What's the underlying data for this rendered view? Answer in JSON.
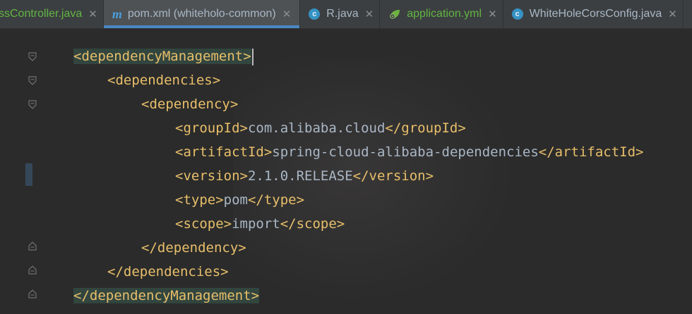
{
  "tabs": [
    {
      "label": "ssController.java",
      "icon": "none",
      "active": false
    },
    {
      "label": "pom.xml (whiteholo-common)",
      "icon": "maven-m-icon",
      "active": true
    },
    {
      "label": "R.java",
      "icon": "class-c-icon",
      "active": false
    },
    {
      "label": "application.yml",
      "icon": "spring-leaf-icon",
      "active": false
    },
    {
      "label": "WhiteHoleCorsConfig.java",
      "icon": "class-c-icon",
      "active": false
    }
  ],
  "close_glyph": "✕",
  "code": {
    "l1": {
      "open": "<dependencyManagement>"
    },
    "l2": {
      "open": "<dependencies>"
    },
    "l3": {
      "open": "<dependency>"
    },
    "l4": {
      "open": "<groupId>",
      "value": "com.alibaba.cloud",
      "close": "</groupId>"
    },
    "l5": {
      "open": "<artifactId>",
      "value": "spring-cloud-alibaba-dependencies",
      "close": "</artifactId>"
    },
    "l6": {
      "open": "<version>",
      "value": "2.1.0.RELEASE",
      "close": "</version>"
    },
    "l7": {
      "open": "<type>",
      "value": "pom",
      "close": "</type>"
    },
    "l8": {
      "open": "<scope>",
      "value": "import",
      "close": "</scope>"
    },
    "l9": {
      "close": "</dependency>"
    },
    "l10": {
      "close": "</dependencies>"
    },
    "l11": {
      "close": "</dependencyManagement>"
    }
  },
  "colors": {
    "tag": "#e8bf6a",
    "text": "#a9b7c6",
    "background": "#2b2b2b",
    "tab_active_underline": "#4a88c7",
    "matched_tag_highlight": "#32453f"
  }
}
